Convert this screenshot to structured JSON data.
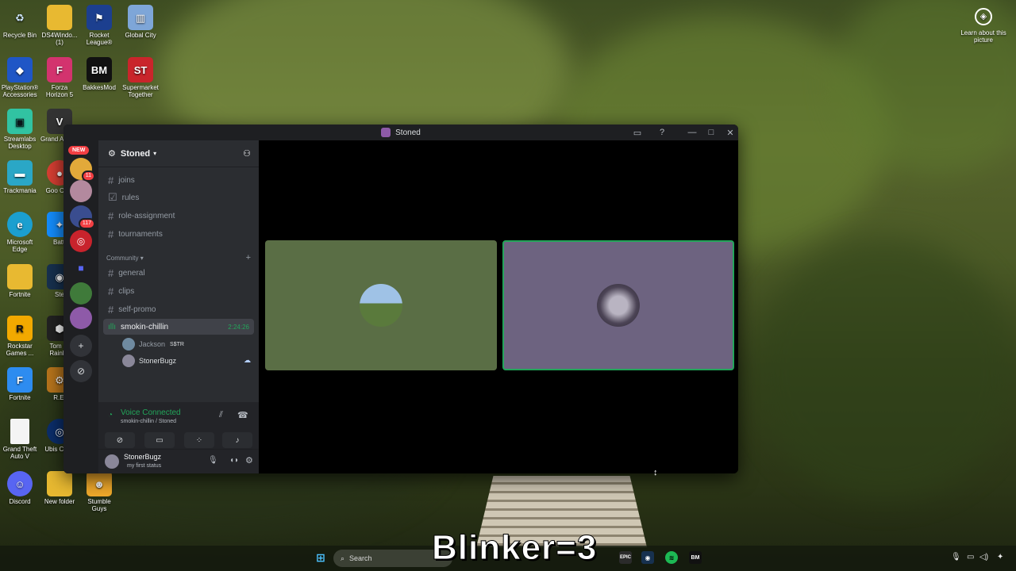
{
  "colors": {
    "discord_blurple": "#5865f2",
    "voice_green": "#23a55a",
    "tile_left_bg": "#5a6e45",
    "tile_right_bg": "#6d6380",
    "speaking_border": "#23a55a"
  },
  "desktop": {
    "icons": [
      {
        "label": "Recycle Bin",
        "icon": "recycle-bin-icon"
      },
      {
        "label": "DS4Windo... (1)",
        "icon": "ds4windows-icon"
      },
      {
        "label": "Rocket League®",
        "icon": "rocket-league-icon"
      },
      {
        "label": "Global City",
        "icon": "global-city-icon"
      },
      {
        "label": "PlayStation® Accessories",
        "icon": "playstation-icon"
      },
      {
        "label": "Forza Horizon 5",
        "icon": "forza-icon"
      },
      {
        "label": "BakkesMod",
        "icon": "bakkesmod-icon"
      },
      {
        "label": "Supermarket Together",
        "icon": "supermarket-icon"
      },
      {
        "label": "Streamlabs Desktop",
        "icon": "streamlabs-icon"
      },
      {
        "label": "Grand Auto V",
        "icon": "gta-icon"
      },
      {
        "label": "Trackmania",
        "icon": "trackmania-icon"
      },
      {
        "label": "Goo Chro",
        "icon": "chrome-icon"
      },
      {
        "label": "Microsoft Edge",
        "icon": "edge-icon"
      },
      {
        "label": "Battl",
        "icon": "battlenet-icon"
      },
      {
        "label": "Fortnite",
        "icon": "folder-icon"
      },
      {
        "label": "Ste",
        "icon": "steam-icon"
      },
      {
        "label": "Rockstar Games ...",
        "icon": "rockstar-icon"
      },
      {
        "label": "Tom Cl Rainbo",
        "icon": "rainbow-icon"
      },
      {
        "label": "Fortnite",
        "icon": "fortnite-icon"
      },
      {
        "label": "R.E.",
        "icon": "re-icon"
      },
      {
        "label": "Grand Theft Auto V",
        "icon": "file-icon"
      },
      {
        "label": "Ubis Conn",
        "icon": "ubisoft-icon"
      },
      {
        "label": "Discord",
        "icon": "discord-icon"
      },
      {
        "label": "New folder",
        "icon": "folder-icon"
      },
      {
        "label": "Stumble Guys",
        "icon": "stumble-guys-icon"
      }
    ],
    "learn_about": "Learn about this picture"
  },
  "window": {
    "title": "Stoned"
  },
  "guilds": {
    "new_label": "NEW",
    "badges": [
      "11",
      "117"
    ]
  },
  "server": {
    "name": "Stoned",
    "channels_top": [
      "joins",
      "rules",
      "role-assignment",
      "tournaments"
    ],
    "category": "Community",
    "channels_community": [
      "general",
      "clips",
      "self-promo"
    ],
    "voice_channel": {
      "name": "smokin-chillin",
      "timer": "2:24:26",
      "users": [
        {
          "name": "Jackson",
          "tag": "S$TR"
        },
        {
          "name": "StonerBugz"
        }
      ]
    }
  },
  "voice_panel": {
    "status": "Voice Connected",
    "location": "smokin-chillin / Stoned"
  },
  "user_panel": {
    "username": "StonerBugz",
    "status": "my first status"
  },
  "taskbar": {
    "search_placeholder": "Search"
  },
  "overlay": {
    "text": "Blinker=3"
  }
}
